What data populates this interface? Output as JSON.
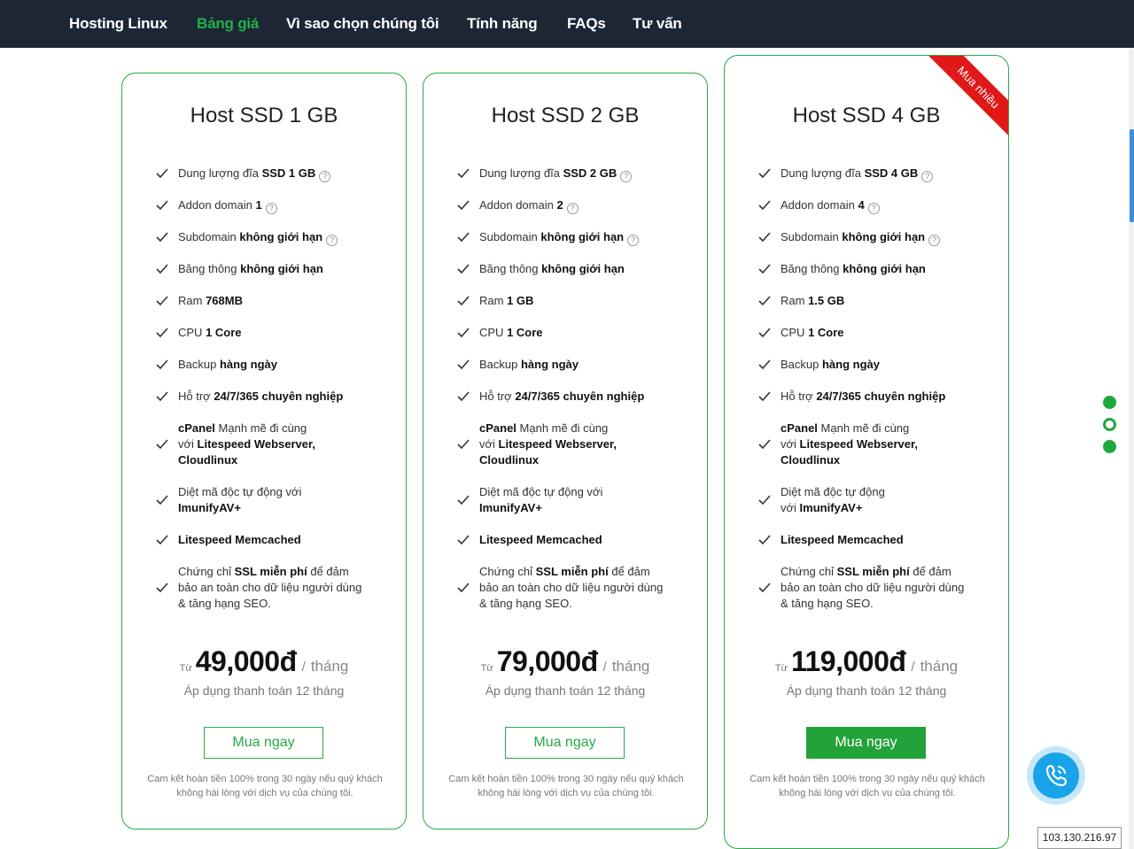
{
  "nav": {
    "items": [
      {
        "label": "Hosting Linux",
        "active": false
      },
      {
        "label": "Bảng giá",
        "active": true
      },
      {
        "label": "Vì sao chọn chúng tôi",
        "active": false
      },
      {
        "label": "Tính năng",
        "active": false
      },
      {
        "label": "FAQs",
        "active": false
      },
      {
        "label": "Tư vấn",
        "active": false
      }
    ]
  },
  "plans": [
    {
      "title": "Host SSD 1 GB",
      "features": [
        {
          "html": "Dung lượng đĩa <b>SSD 1 GB</b>",
          "help": true
        },
        {
          "html": "Addon domain <b>1</b>",
          "help": true
        },
        {
          "html": "Subdomain <b>không giới hạn</b>",
          "help": true
        },
        {
          "html": "Băng thông <b>không giới hạn</b>",
          "help": false
        },
        {
          "html": "Ram <b>768MB</b>",
          "help": false
        },
        {
          "html": "CPU <b>1 Core</b>",
          "help": false
        },
        {
          "html": "Backup <b>hàng ngày</b>",
          "help": false
        },
        {
          "html": "Hỗ trợ <b>24/7/365 chuyên nghiệp</b>",
          "help": false
        },
        {
          "html": "<b>cPanel</b> Mạnh mẽ đi cùng<br>với <b>Litespeed Webserver,<br>Cloudlinux</b>",
          "help": false
        },
        {
          "html": "Diệt mã độc tự động với<br><b>ImunifyAV+</b>",
          "help": false
        },
        {
          "html": "<b>Litespeed Memcached</b>",
          "help": false
        },
        {
          "html": "Chứng chỉ <b>SSL miễn phí</b> để đảm<br>bảo an toàn cho dữ liệu người dùng<br>&amp; tăng hạng SEO.",
          "help": false
        }
      ],
      "price_from": "Từ",
      "price": "49,000đ",
      "price_sep": "/",
      "price_unit": "tháng",
      "price_note": "Áp dụng thanh toán 12 tháng",
      "button": "Mua ngay",
      "guarantee": "Cam kết hoàn tiền 100% trong 30 ngày nếu quý khách không hài lòng với dịch vụ của chúng tôi.",
      "ribbon": ""
    },
    {
      "title": "Host SSD 2 GB",
      "features": [
        {
          "html": "Dung lượng đĩa <b>SSD 2 GB</b>",
          "help": true
        },
        {
          "html": "Addon domain <b>2</b>",
          "help": true
        },
        {
          "html": "Subdomain <b>không giới hạn</b>",
          "help": true
        },
        {
          "html": "Băng thông <b>không giới hạn</b>",
          "help": false
        },
        {
          "html": "Ram <b>1 GB</b>",
          "help": false
        },
        {
          "html": "CPU <b>1 Core</b>",
          "help": false
        },
        {
          "html": "Backup <b>hàng ngày</b>",
          "help": false
        },
        {
          "html": "Hỗ trợ <b>24/7/365 chuyên nghiệp</b>",
          "help": false
        },
        {
          "html": "<b>cPanel</b> Mạnh mẽ đi cùng<br>với <b>Litespeed Webserver,<br>Cloudlinux</b>",
          "help": false
        },
        {
          "html": "Diệt mã độc tự động với<br><b>ImunifyAV+</b>",
          "help": false
        },
        {
          "html": "<b>Litespeed Memcached</b>",
          "help": false
        },
        {
          "html": "Chứng chỉ <b>SSL miễn phí</b> để đảm<br>bảo an toàn cho dữ liệu người dùng<br>&amp; tăng hạng SEO.",
          "help": false
        }
      ],
      "price_from": "Từ",
      "price": "79,000đ",
      "price_sep": "/",
      "price_unit": "tháng",
      "price_note": "Áp dụng thanh toán 12 tháng",
      "button": "Mua ngay",
      "guarantee": "Cam kết hoàn tiền 100% trong 30 ngày nếu quý khách không hài lòng với dịch vụ của chúng tôi.",
      "ribbon": ""
    },
    {
      "title": "Host SSD 4 GB",
      "features": [
        {
          "html": "Dung lượng đĩa <b>SSD 4 GB</b>",
          "help": true
        },
        {
          "html": "Addon domain <b>4</b>",
          "help": true
        },
        {
          "html": "Subdomain <b>không giới hạn</b>",
          "help": true
        },
        {
          "html": "Băng thông <b>không giới hạn</b>",
          "help": false
        },
        {
          "html": "Ram <b>1.5 GB</b>",
          "help": false
        },
        {
          "html": "CPU <b>1 Core</b>",
          "help": false
        },
        {
          "html": "Backup <b>hàng ngày</b>",
          "help": false
        },
        {
          "html": "Hỗ trợ <b>24/7/365 chuyên nghiệp</b>",
          "help": false
        },
        {
          "html": "<b>cPanel</b> Mạnh mẽ đi cùng<br>với <b>Litespeed Webserver,<br>Cloudlinux</b>",
          "help": false
        },
        {
          "html": "Diệt mã độc tự động<br>với <b>ImunifyAV+</b>",
          "help": false
        },
        {
          "html": "<b>Litespeed Memcached</b>",
          "help": false
        },
        {
          "html": "Chứng chỉ <b>SSL miễn phí</b> để đảm<br>bảo an toàn cho dữ liệu người dùng<br>&amp; tăng hạng SEO.",
          "help": false
        }
      ],
      "price_from": "Từ",
      "price": "119,000đ",
      "price_sep": "/",
      "price_unit": "tháng",
      "price_note": "Áp dụng thanh toán 12 tháng",
      "button": "Mua ngay",
      "guarantee": "Cam kết hoàn tiền 100% trong 30 ngày nếu quý khách không hài lòng với dịch vụ của chúng tôi.",
      "ribbon": "Mua nhiều"
    }
  ],
  "side_dots": [
    {
      "state": "filled"
    },
    {
      "state": "hollow"
    },
    {
      "state": "filled"
    }
  ],
  "contact": {
    "icon": "phone-icon"
  },
  "ip_badge": "103.130.216.97",
  "colors": {
    "nav_bg": "#1d2634",
    "accent": "#1fb14a",
    "ribbon": "#e01818",
    "call": "#19a3e8"
  }
}
